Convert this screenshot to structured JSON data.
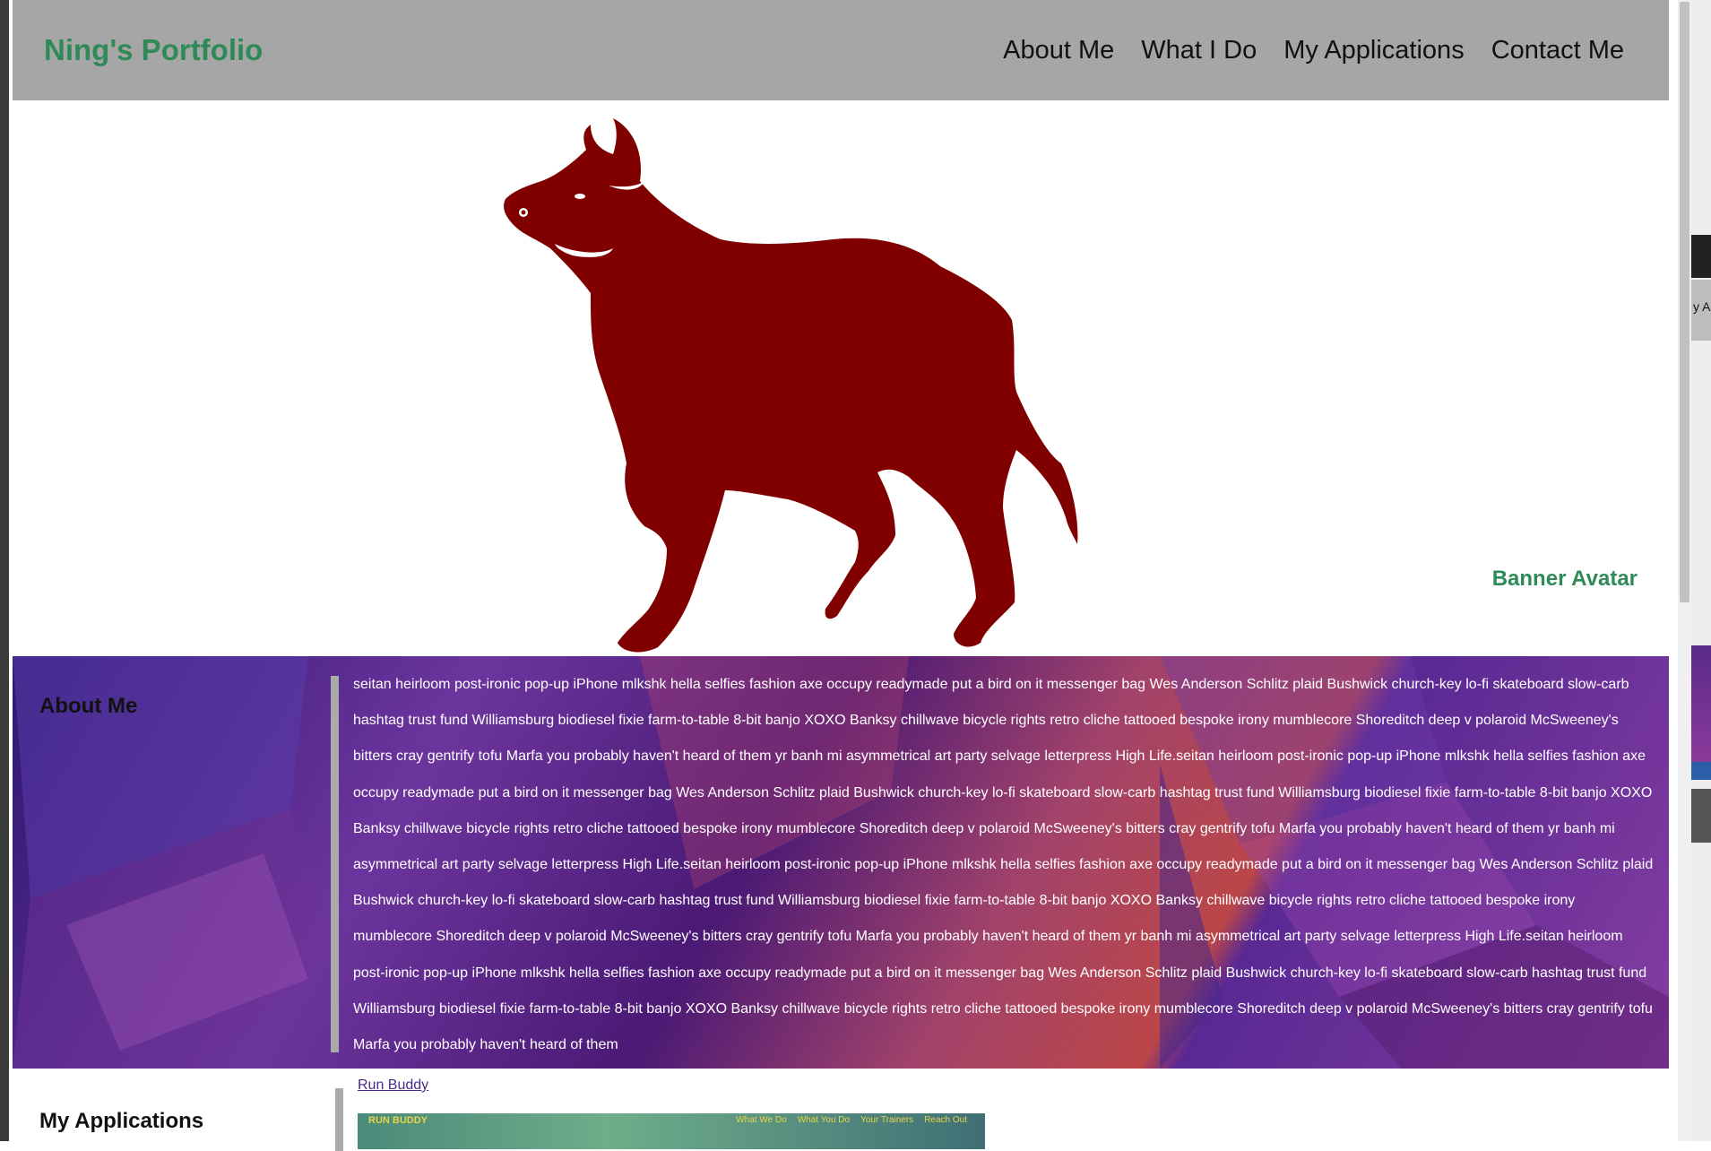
{
  "header": {
    "brand": "Ning's Portfolio",
    "nav": [
      {
        "label": "About Me"
      },
      {
        "label": "What I Do"
      },
      {
        "label": "My Applications"
      },
      {
        "label": "Contact Me"
      }
    ]
  },
  "banner": {
    "label": "Banner Avatar",
    "image_icon": "bull-silhouette-icon"
  },
  "about": {
    "title": "About Me",
    "text": "seitan heirloom post-ironic pop-up iPhone mlkshk hella selfies fashion axe occupy readymade put a bird on it messenger bag Wes Anderson Schlitz plaid Bushwick church-key lo-fi skateboard slow-carb hashtag trust fund Williamsburg biodiesel fixie farm-to-table 8-bit banjo XOXO Banksy chillwave bicycle rights retro cliche tattooed bespoke irony mumblecore Shoreditch deep v polaroid McSweeney's bitters cray gentrify tofu Marfa you probably haven't heard of them yr banh mi asymmetrical art party selvage letterpress High Life.seitan heirloom post-ironic pop-up iPhone mlkshk hella selfies fashion axe occupy readymade put a bird on it messenger bag Wes Anderson Schlitz plaid Bushwick church-key lo-fi skateboard slow-carb hashtag trust fund Williamsburg biodiesel fixie farm-to-table 8-bit banjo XOXO Banksy chillwave bicycle rights retro cliche tattooed bespoke irony mumblecore Shoreditch deep v polaroid McSweeney's bitters cray gentrify tofu Marfa you probably haven't heard of them yr banh mi asymmetrical art party selvage letterpress High Life.seitan heirloom post-ironic pop-up iPhone mlkshk hella selfies fashion axe occupy readymade put a bird on it messenger bag Wes Anderson Schlitz plaid Bushwick church-key lo-fi skateboard slow-carb hashtag trust fund Williamsburg biodiesel fixie farm-to-table 8-bit banjo XOXO Banksy chillwave bicycle rights retro cliche tattooed bespoke irony mumblecore Shoreditch deep v polaroid McSweeney's bitters cray gentrify tofu Marfa you probably haven't heard of them yr banh mi asymmetrical art party selvage letterpress High Life.seitan heirloom post-ironic pop-up iPhone mlkshk hella selfies fashion axe occupy readymade put a bird on it messenger bag Wes Anderson Schlitz plaid Bushwick church-key lo-fi skateboard slow-carb hashtag trust fund Williamsburg biodiesel fixie farm-to-table 8-bit banjo XOXO Banksy chillwave bicycle rights retro cliche tattooed bespoke irony mumblecore Shoreditch deep v polaroid McSweeney's bitters cray gentrify tofu Marfa you probably haven't heard of them"
  },
  "applications": {
    "title": "My Applications",
    "items": [
      {
        "link_label": "Run Buddy",
        "thumb_title": "RUN BUDDY",
        "thumb_nav": [
          "What We Do",
          "What You Do",
          "Your Trainers",
          "Reach Out"
        ]
      }
    ]
  },
  "side_window": {
    "label_fragment": "y A"
  },
  "colors": {
    "brand": "#2e8b57",
    "header_bg": "#a6a6a6",
    "bull": "#800000",
    "link": "#4b2a8a"
  }
}
